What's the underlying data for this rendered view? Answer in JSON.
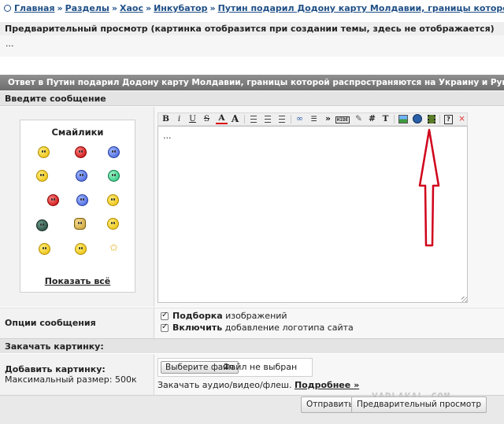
{
  "breadcrumb": {
    "items": [
      "Главная",
      "Разделы",
      "Хаос",
      "Инкубатор",
      "Путин подарил Додону карту Молдавии, границы которой распространяются на Украину и Румынию."
    ],
    "separator": "»"
  },
  "preview": {
    "header": "Предварительный просмотр (картинка отобразится при создании темы, здесь не отображается)",
    "content": "..."
  },
  "reply": {
    "title": "Ответ в Путин подарил Додону карту Молдавии, границы которой распространяются на Украину и Румынию."
  },
  "message": {
    "header": "Введите сообщение",
    "text": "..."
  },
  "smilies": {
    "title": "Смайлики",
    "show_all": "Показать всё"
  },
  "toolbar": {
    "bold": "B",
    "italic": "i",
    "underline": "U",
    "strike": "S",
    "font_color": "A",
    "font_size": "A",
    "quote": "»",
    "hide": "HIDE",
    "hash": "#",
    "typeface": "T",
    "help": "?",
    "close": "×"
  },
  "options": {
    "label": "Опции сообщения",
    "opt1_bold": "Подборка",
    "opt1_rest": "изображений",
    "opt2_bold": "Включить",
    "opt2_rest": "добавление логотипа сайта"
  },
  "upload": {
    "header": "Закачать картинку:",
    "add_label": "Добавить картинку:",
    "max_size": "Максимальный размер: 500к",
    "choose_file": "Выберите файл",
    "no_file": "Файл не выбран",
    "flash_text": "Закачать аудио/видео/флеш.",
    "more_link": "Подробнее »"
  },
  "buttons": {
    "submit": "Отправить",
    "preview": "Предварительный просмотр"
  },
  "watermark": "YAPLAKAL.COM",
  "colors": {
    "link": "#1f4f86",
    "arrow": "#d0021b",
    "reply_bar": "#7d7d7d"
  }
}
